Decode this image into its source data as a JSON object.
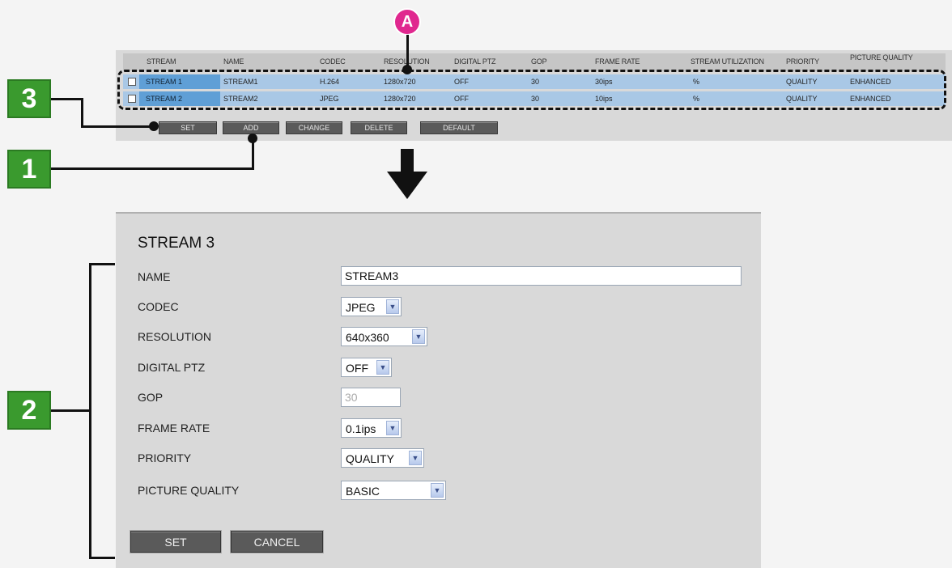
{
  "table": {
    "headers": [
      "STREAM",
      "NAME",
      "CODEC",
      "RESOLUTION",
      "DIGITAL PTZ",
      "GOP",
      "FRAME RATE",
      "STREAM UTILIZATION",
      "PRIORITY",
      "PICTURE QUALITY"
    ],
    "rows": [
      {
        "stream": "STREAM 1",
        "name": "STREAM1",
        "codec": "H.264",
        "resolution": "1280x720",
        "digital_ptz": "OFF",
        "gop": "30",
        "frame_rate": "30ips",
        "utilization": "%",
        "priority": "QUALITY",
        "picture_quality": "ENHANCED"
      },
      {
        "stream": "STREAM 2",
        "name": "STREAM2",
        "codec": "JPEG",
        "resolution": "1280x720",
        "digital_ptz": "OFF",
        "gop": "30",
        "frame_rate": "10ips",
        "utilization": "%",
        "priority": "QUALITY",
        "picture_quality": "ENHANCED"
      }
    ],
    "buttons": {
      "set": "SET",
      "add": "ADD",
      "change": "CHANGE",
      "delete": "DELETE",
      "default": "DEFAULT"
    }
  },
  "callouts": {
    "one": "1",
    "two": "2",
    "three": "3",
    "a": "A"
  },
  "dialog": {
    "title": "STREAM 3",
    "labels": {
      "name": "NAME",
      "codec": "CODEC",
      "resolution": "RESOLUTION",
      "digital_ptz": "DIGITAL PTZ",
      "gop": "GOP",
      "frame_rate": "FRAME RATE",
      "priority": "PRIORITY",
      "picture_quality": "PICTURE QUALITY"
    },
    "values": {
      "name": "STREAM3",
      "codec": "JPEG",
      "resolution": "640x360",
      "digital_ptz": "OFF",
      "gop": "30",
      "frame_rate": "0.1ips",
      "priority": "QUALITY",
      "picture_quality": "BASIC"
    },
    "buttons": {
      "set": "SET",
      "cancel": "CANCEL"
    }
  },
  "icons": {
    "arrow": "down-arrow-icon",
    "chevron": "chevron-down-icon"
  }
}
